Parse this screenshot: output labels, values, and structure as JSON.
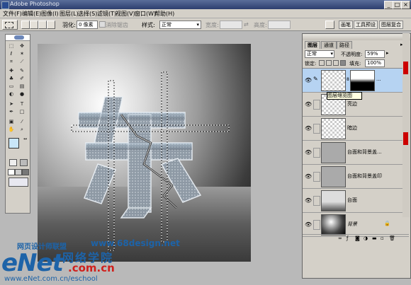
{
  "window": {
    "title": "Adobe Photoshop"
  },
  "menu": [
    "文件(F)",
    "编辑(E)",
    "图像(I)",
    "图层(L)",
    "选择(S)",
    "滤镜(T)",
    "视图(V)",
    "窗口(W)",
    "帮助(H)"
  ],
  "options": {
    "feather_label": "羽化:",
    "feather_value": "0 像素",
    "antialias_label": "消除锯齿",
    "style_label": "样式:",
    "style_value": "正常",
    "width_label": "宽度:",
    "height_label": "高度:"
  },
  "workspace_tabs": [
    "画笔",
    "工具预设",
    "图层复合"
  ],
  "layers_panel": {
    "tabs": [
      "图层",
      "通道",
      "路径"
    ],
    "blend_mode": "正常",
    "opacity_label": "不透明度:",
    "opacity_value": "59%",
    "lock_label": "锁定:",
    "fill_label": "填充:",
    "fill_value": "100%",
    "tooltip": "图层缩览图",
    "layers": [
      {
        "name": "...",
        "selected": true
      },
      {
        "name": "亮边"
      },
      {
        "name": "暗边"
      },
      {
        "name": "台面和背景盖..."
      },
      {
        "name": "台面和背景盖印"
      },
      {
        "name": "台面"
      },
      {
        "name": "背景"
      }
    ]
  },
  "watermark": {
    "site_cn": "网页设计师联盟",
    "site_url": "www.68design.net",
    "brand": "eNet",
    "brand_suffix": ".com.cn",
    "brand_cn": "网络学院",
    "school_url": "www.eNet.com.cn/eschool"
  },
  "colors": {
    "title_bar": "#2c3e6e",
    "selection_highlight": "#b6d3f2",
    "watermark_blue": "#1d63a8",
    "watermark_red": "#d0201c"
  }
}
